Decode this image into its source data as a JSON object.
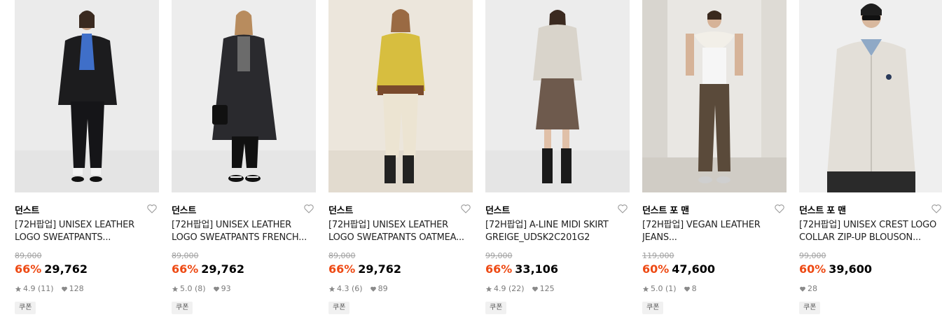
{
  "products": [
    {
      "brand": "던스트",
      "title_line1": "[72H팝업] UNISEX LEATHER",
      "title_line2": "LOGO SWEATPANTS...",
      "original_price": "89,000",
      "discount": "66%",
      "price": "29,762",
      "rating": "4.9",
      "reviews": "(11)",
      "likes": "128",
      "coupon": "쿠폰"
    },
    {
      "brand": "던스트",
      "title_line1": "[72H팝업] UNISEX LEATHER",
      "title_line2": "LOGO SWEATPANTS FRENCH...",
      "original_price": "89,000",
      "discount": "66%",
      "price": "29,762",
      "rating": "5.0",
      "reviews": "(8)",
      "likes": "93",
      "coupon": "쿠폰"
    },
    {
      "brand": "던스트",
      "title_line1": "[72H팝업] UNISEX LEATHER",
      "title_line2": "LOGO SWEATPANTS OATMEA...",
      "original_price": "89,000",
      "discount": "66%",
      "price": "29,762",
      "rating": "4.3",
      "reviews": "(6)",
      "likes": "89",
      "coupon": "쿠폰"
    },
    {
      "brand": "던스트",
      "title_line1": "[72H팝업] A-LINE MIDI SKIRT",
      "title_line2": "GREIGE_UDSK2C201G2",
      "original_price": "99,000",
      "discount": "66%",
      "price": "33,106",
      "rating": "4.9",
      "reviews": "(22)",
      "likes": "125",
      "coupon": "쿠폰"
    },
    {
      "brand": "던스트 포 맨",
      "title_line1": "[72H팝업] VEGAN LEATHER",
      "title_line2": "JEANS...",
      "original_price": "119,000",
      "discount": "60%",
      "price": "47,600",
      "rating": "5.0",
      "reviews": "(1)",
      "likes": "8",
      "coupon": "쿠폰"
    },
    {
      "brand": "던스트 포 맨",
      "title_line1": "[72H팝업] UNISEX CREST LOGO",
      "title_line2": "COLLAR ZIP-UP BLOUSON...",
      "original_price": "99,000",
      "discount": "60%",
      "price": "39,600",
      "rating": "",
      "reviews": "",
      "likes": "28",
      "coupon": "쿠폰"
    }
  ],
  "colors": {
    "discount": "#ee4a14",
    "muted": "#7a7a7a",
    "strike": "#a0a0a0"
  },
  "icons": {
    "wishlist": "heart-outline-icon",
    "rating": "star-icon",
    "likes": "heart-filled-icon"
  }
}
